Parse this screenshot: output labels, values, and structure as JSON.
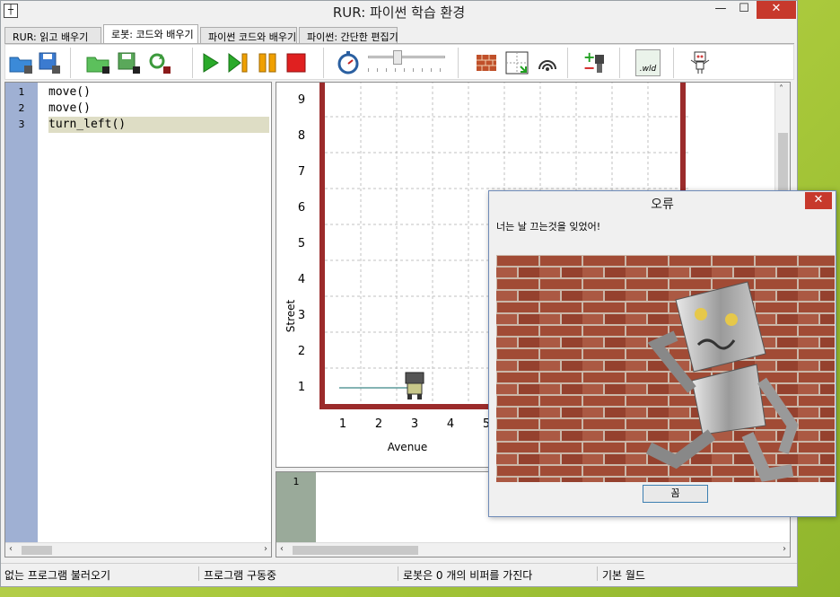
{
  "window": {
    "title": "RUR: 파이썬 학습 환경",
    "icon": "app-icon",
    "min": "—",
    "max": "☐",
    "close": "✕"
  },
  "tabs": [
    {
      "label": "RUR: 읽고 배우기"
    },
    {
      "label": "로봇: 코드와 배우기"
    },
    {
      "label": "파이썬 코드와 배우기"
    },
    {
      "label": "파이썬: 간단한 편집기"
    }
  ],
  "toolbar": {
    "icons": [
      "open-world-icon",
      "save-world-icon",
      "open-program-icon",
      "save-program-icon",
      "reload-program-icon",
      "run-icon",
      "step-icon",
      "pause-icon",
      "stop-icon",
      "timer-icon",
      "speed-slider",
      "edit-walls-icon",
      "resize-world-icon",
      "beepers-icon",
      "add-remove-beepers-icon",
      "world-file-icon",
      "robot-icon"
    ],
    "world_file_label": ".wld",
    "beeper_plus": "+",
    "beeper_minus": "−"
  },
  "editor": {
    "lines": [
      {
        "no": "1",
        "code": "move()"
      },
      {
        "no": "2",
        "code": "move()"
      },
      {
        "no": "3",
        "code": "turn_left()"
      }
    ],
    "scroll_left": "‹",
    "scroll_right": "›"
  },
  "world": {
    "ylabel": "Street",
    "xlabel": "Avenue",
    "x_ticks": [
      "1",
      "2",
      "3",
      "4",
      "5"
    ],
    "y_ticks": [
      "1",
      "2",
      "3",
      "4",
      "5",
      "6",
      "7",
      "8",
      "9"
    ],
    "robot_position": {
      "avenue": 3,
      "street": 1
    },
    "trace_from_avenue": 1,
    "scroll_up": "˄",
    "colors": {
      "wall": "#9b2b2b",
      "grid": "#c0c0c0",
      "trace": "#5c9a9a"
    }
  },
  "console": {
    "lines": [
      {
        "no": "1"
      }
    ],
    "scroll_left": "‹",
    "scroll_right": "›"
  },
  "status": [
    "없는 프로그램 불러오기",
    "프로그램 구동중",
    "로봇은 0 개의 비퍼를 가진다",
    "기본 월드"
  ],
  "dialog": {
    "title": "오류",
    "close": "✕",
    "message": "너는 날 끄는것을 잊었어!",
    "ok_label": "꼼"
  }
}
